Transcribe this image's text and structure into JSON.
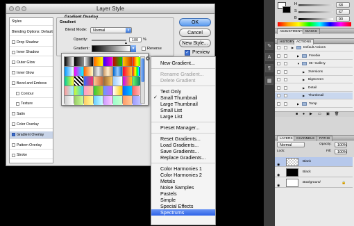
{
  "dialog": {
    "title": "Layer Style",
    "section_title": "Gradient Overlay",
    "group_title": "Gradient",
    "blend_mode_label": "Blend Mode:",
    "blend_mode_value": "Normal",
    "opacity_label": "Opacity:",
    "opacity_value": "100",
    "opacity_unit": "%",
    "gradient_label": "Gradient:",
    "reverse_label": "Reverse",
    "buttons": {
      "ok": "OK",
      "cancel": "Cancel",
      "new_style": "New Style...",
      "preview": "Preview"
    }
  },
  "styles_list": [
    {
      "label": "Styles",
      "type": "header"
    },
    {
      "label": "Blending Options: Default",
      "type": "header"
    },
    {
      "label": "Drop Shadow"
    },
    {
      "label": "Inner Shadow"
    },
    {
      "label": "Outer Glow"
    },
    {
      "label": "Inner Glow"
    },
    {
      "label": "Bevel and Emboss"
    },
    {
      "label": "Contour",
      "indent": true
    },
    {
      "label": "Texture",
      "indent": true
    },
    {
      "label": "Satin"
    },
    {
      "label": "Color Overlay"
    },
    {
      "label": "Gradient Overlay",
      "selected": true
    },
    {
      "label": "Pattern Overlay"
    },
    {
      "label": "Stroke"
    }
  ],
  "menu": {
    "items": [
      {
        "label": "New Gradient..."
      },
      "sep",
      {
        "label": "Rename Gradient...",
        "disabled": true
      },
      {
        "label": "Delete Gradient",
        "disabled": true
      },
      "sep",
      {
        "label": "Text Only"
      },
      {
        "label": "Small Thumbnail",
        "checked": true
      },
      {
        "label": "Large Thumbnail"
      },
      {
        "label": "Small List"
      },
      {
        "label": "Large List"
      },
      "sep",
      {
        "label": "Preset Manager..."
      },
      "sep",
      {
        "label": "Reset Gradients..."
      },
      {
        "label": "Load Gradients..."
      },
      {
        "label": "Save Gradients..."
      },
      {
        "label": "Replace Gradients..."
      },
      "sep",
      {
        "label": "Color Harmonies 1"
      },
      {
        "label": "Color Harmonies 2"
      },
      {
        "label": "Metals"
      },
      {
        "label": "Noise Samples"
      },
      {
        "label": "Pastels"
      },
      {
        "label": "Simple"
      },
      {
        "label": "Special Effects"
      },
      {
        "label": "Spectrums",
        "highlighted": true
      }
    ]
  },
  "color_panel": {
    "values": [
      "68",
      "67",
      "90"
    ],
    "slider_labels": [
      "H",
      "S",
      "B"
    ]
  },
  "adjustments_tabs": [
    "ADJUSTMENTS",
    "MASKS"
  ],
  "history_tabs": [
    "HISTORY",
    "ACTIONS"
  ],
  "actions": [
    {
      "label": "Default Actions",
      "level": 0,
      "folder": true
    },
    {
      "label": "Freebie",
      "level": 1,
      "folder": true
    },
    {
      "label": "05--Gallery",
      "level": 1,
      "folder": true,
      "open": true
    },
    {
      "label": "3Versions",
      "level": 2
    },
    {
      "label": "BigScreen",
      "level": 2
    },
    {
      "label": "Detail",
      "level": 2
    },
    {
      "label": "Thumbnail",
      "level": 2,
      "selected": true
    },
    {
      "label": "Temp",
      "level": 1,
      "folder": true
    }
  ],
  "layers_tabs": [
    "LAYERS",
    "CHANNELS",
    "PATHS"
  ],
  "layers_blend": "Normal",
  "layers_opacity_label": "Opacity:",
  "layers_opacity_value": "100%",
  "layers_lock_label": "Lock:",
  "layers_fill_label": "Fill:",
  "layers_fill_value": "100%",
  "layers": [
    {
      "label": "Blank",
      "selected": true,
      "thumb": "#ffffff"
    },
    {
      "label": "Black",
      "thumb": "#000000"
    },
    {
      "label": "Background",
      "thumb": "#ffffff",
      "locked": true
    }
  ],
  "colors": {
    "accent": "#3b6fd1",
    "menu_highlight": "#2d62e8"
  }
}
